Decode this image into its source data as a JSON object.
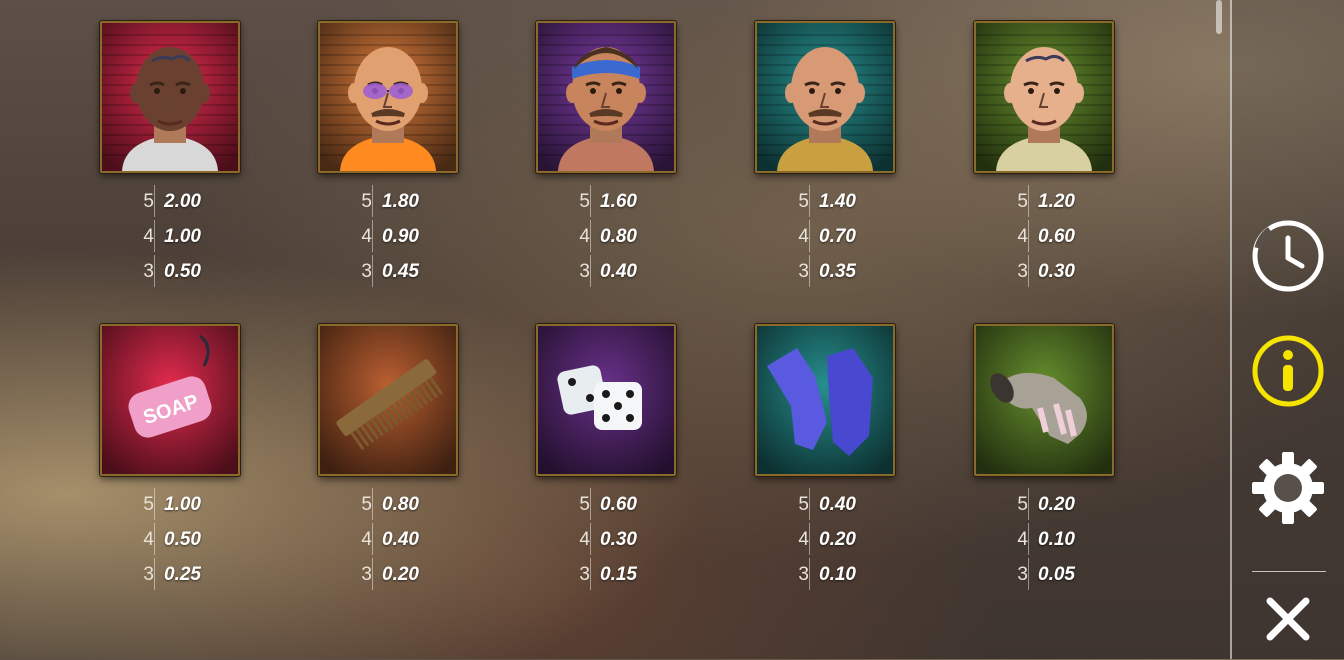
{
  "paytable": {
    "high_symbols": [
      {
        "name": "Prisoner with head tattoos",
        "icon": "prisoner-tattooed-icon",
        "color": "#a8203a",
        "pays": [
          {
            "count": "5",
            "value": "2.00"
          },
          {
            "count": "4",
            "value": "1.00"
          },
          {
            "count": "3",
            "value": "0.50"
          }
        ]
      },
      {
        "name": "Prisoner with purple glasses",
        "icon": "prisoner-glasses-icon",
        "color": "#a05a2c",
        "pays": [
          {
            "count": "5",
            "value": "1.80"
          },
          {
            "count": "4",
            "value": "0.90"
          },
          {
            "count": "3",
            "value": "0.45"
          }
        ]
      },
      {
        "name": "Prisoner with bandana",
        "icon": "prisoner-bandana-icon",
        "color": "#5a2c78",
        "pays": [
          {
            "count": "5",
            "value": "1.60"
          },
          {
            "count": "4",
            "value": "0.80"
          },
          {
            "count": "3",
            "value": "0.40"
          }
        ]
      },
      {
        "name": "Bald prisoner",
        "icon": "prisoner-bald-icon",
        "color": "#1d6a6a",
        "pays": [
          {
            "count": "5",
            "value": "1.40"
          },
          {
            "count": "4",
            "value": "0.70"
          },
          {
            "count": "3",
            "value": "0.35"
          }
        ]
      },
      {
        "name": "Prisoner with face tattoo",
        "icon": "prisoner-face-tattoo-icon",
        "color": "#4c6a22",
        "pays": [
          {
            "count": "5",
            "value": "1.20"
          },
          {
            "count": "4",
            "value": "0.60"
          },
          {
            "count": "3",
            "value": "0.30"
          }
        ]
      }
    ],
    "low_symbols": [
      {
        "name": "Soap",
        "icon": "soap-icon",
        "color": "#a8203a",
        "text": "SOAP",
        "pays": [
          {
            "count": "5",
            "value": "1.00"
          },
          {
            "count": "4",
            "value": "0.50"
          },
          {
            "count": "3",
            "value": "0.25"
          }
        ]
      },
      {
        "name": "Comb",
        "icon": "comb-icon",
        "color": "#8a4624",
        "pays": [
          {
            "count": "5",
            "value": "0.80"
          },
          {
            "count": "4",
            "value": "0.40"
          },
          {
            "count": "3",
            "value": "0.20"
          }
        ]
      },
      {
        "name": "Dice",
        "icon": "dice-icon",
        "color": "#4e2466",
        "pays": [
          {
            "count": "5",
            "value": "0.60"
          },
          {
            "count": "4",
            "value": "0.30"
          },
          {
            "count": "3",
            "value": "0.15"
          }
        ]
      },
      {
        "name": "Gloves",
        "icon": "gloves-icon",
        "color": "#1d6a6a",
        "pays": [
          {
            "count": "5",
            "value": "0.40"
          },
          {
            "count": "4",
            "value": "0.20"
          },
          {
            "count": "3",
            "value": "0.10"
          }
        ]
      },
      {
        "name": "Sock",
        "icon": "sock-icon",
        "color": "#4c6a22",
        "pays": [
          {
            "count": "5",
            "value": "0.20"
          },
          {
            "count": "4",
            "value": "0.10"
          },
          {
            "count": "3",
            "value": "0.05"
          }
        ]
      }
    ]
  },
  "sidebar": {
    "history_icon": "clock-icon",
    "info_icon": "info-icon",
    "settings_icon": "gear-icon",
    "close_icon": "close-icon",
    "info_color": "#f5e400",
    "icon_color": "#ffffff"
  }
}
